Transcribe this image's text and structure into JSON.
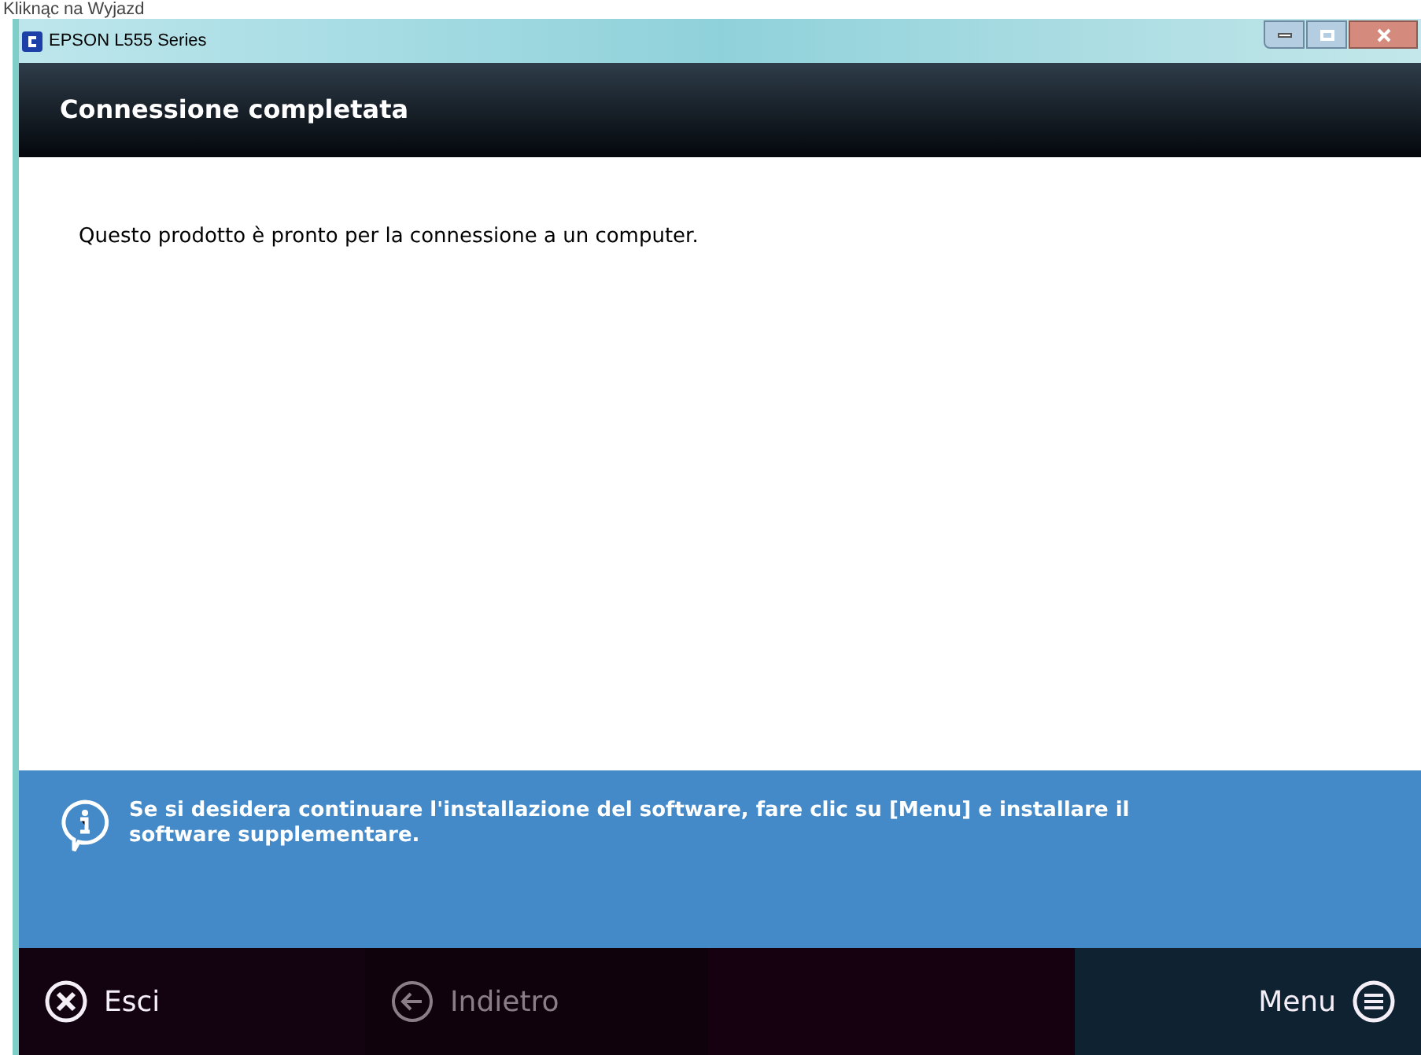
{
  "caption": "Kliknąc na Wyjazd",
  "window": {
    "title": "EPSON L555 Series"
  },
  "header": {
    "title": "Connessione completata"
  },
  "body": {
    "message": "Questo prodotto è pronto per la connessione a un computer."
  },
  "info": {
    "text": "Se si desidera continuare l'installazione del software, fare clic su [Menu] e installare il software supplementare."
  },
  "buttons": [
    {
      "kind": "exit",
      "label": "Esci",
      "disabled": false
    },
    {
      "kind": "back",
      "label": "Indietro",
      "disabled": true
    },
    {
      "kind": "menu",
      "label": "Menu",
      "disabled": false
    }
  ]
}
